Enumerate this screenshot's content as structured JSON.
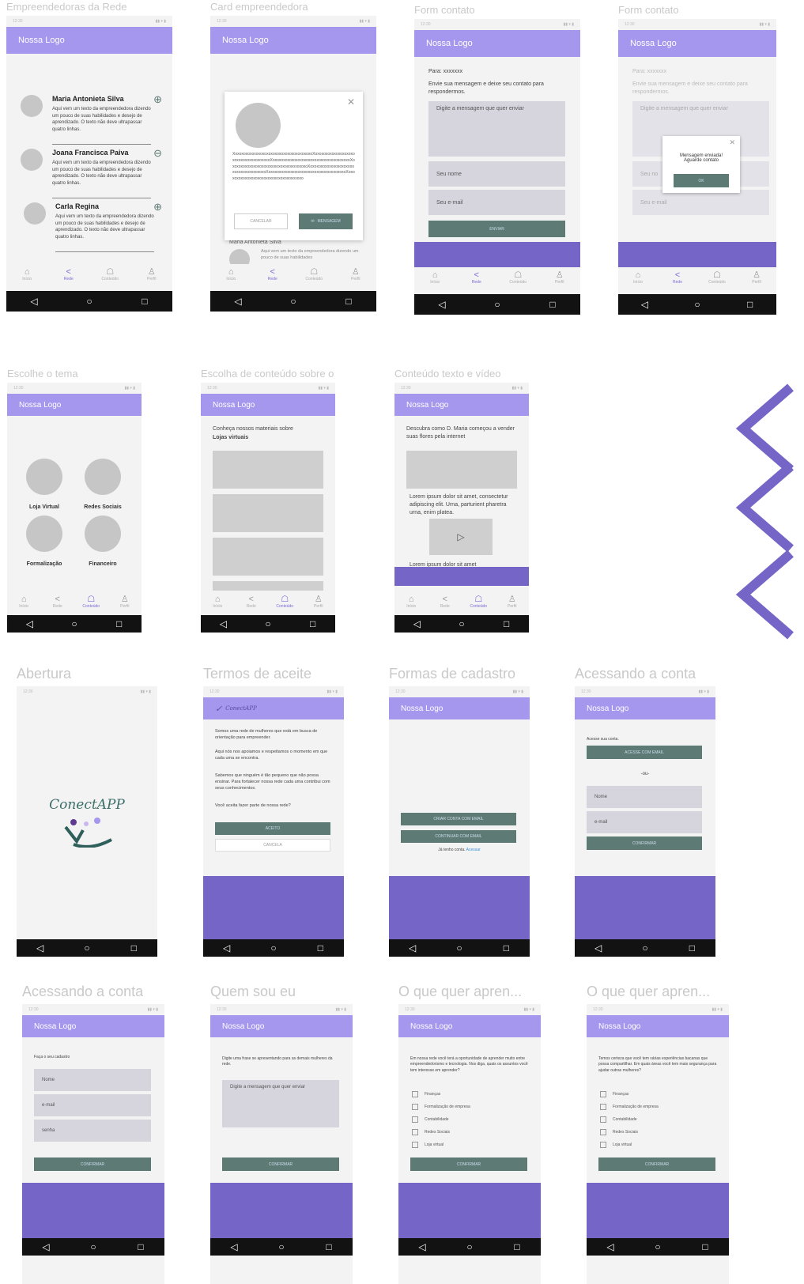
{
  "status_time": "12:30",
  "logo": "Nossa Logo",
  "tabs": [
    "Início",
    "Rede",
    "Conteúdo",
    "Perfil"
  ],
  "nav_glyphs": [
    "◁",
    "○",
    "□"
  ],
  "screens": {
    "s1": {
      "title": "Empreendedoras da Rede",
      "members": [
        {
          "name": "Maria Antonieta Silva",
          "text": "Aqui vem um texto da empreendedora dizendo um pouco de suas habilidades e desejo de aprendizado. O texto não deve ultrapassar quatro linhas.",
          "action": "⊕"
        },
        {
          "name": "Joana Francisca Paiva",
          "text": "Aqui vem um texto da empreendedora dizendo um pouco de suas habilidades e desejo de aprendizado. O texto não deve ultrapassar quatro linhas.",
          "action": "⊖"
        },
        {
          "name": "Carla Regina",
          "text": "Aqui vem um texto da empreendedora dizendo um pouco de suas habilidades e desejo de aprendizado. O texto não deve ultrapassar quatro linhas.",
          "action": "⊕"
        }
      ]
    },
    "s2": {
      "title": "Card empreendedora",
      "xo": "XoxoxoxoxoxoxoxoxoxoxoxoxoxoxoxoxoxoxoXoxoxoxoxoxoxoxoxoxoxoxoxoxoxoxoxoxoxoXoxoxoxoxoxoxoxoxoxoxoxoxoxoxoxoxoxoxoXoxoxoxoxoxoxoxoxoxoxoxoxoxoxoxoxoxoxoXoxoxoxoxoxoxoxoxoxoxoxoxoxoxoxoxoxoxoXoxoxoxoxoxoxoxoxoxoxoxoxoxoxoxoxoxoxoXoxoxoxoxoxoxoxoxoxoxoxoxoxoxoxoxoxoxo",
      "cancel": "CANCELAR",
      "message": "MENSAGEM",
      "behind_name": "Maria Antonieta Silva",
      "behind_text": "Aqui vem um texto da empreendedora dizendo um pouco de suas habilidades"
    },
    "s3": {
      "title": "Form contato",
      "to": "Para: xxxxxxx",
      "intro": "Envie sua mensagem e deixe seu contato para respondermos.",
      "msg": "Digite a mensagem que quer enviar",
      "name": "Seu nome",
      "email": "Seu e-mail",
      "send": "ENVIAR"
    },
    "s4": {
      "title": "Form contato",
      "dialog": "Mensagem enviada! Aguarde contato",
      "ok": "OK",
      "name_partial": "Seu no"
    },
    "s5": {
      "title": "Escolhe o tema",
      "themes": [
        "Loja Virtual",
        "Redes Sociais",
        "Formalização",
        "Financeiro"
      ]
    },
    "s6": {
      "title": "Escolha de conteúdo sobre o te...",
      "intro": "Conheça nossos materiais sobre",
      "bold": "Lojas virtuais"
    },
    "s7": {
      "title": "Conteúdo texto e vídeo",
      "heading": "Descubra como D. Maria começou a vender suas flores pela internet",
      "para": "Lorem ipsum dolor sit amet, consectetur adipiscing elit. Urna, parturient pharetra urna, enim platea.",
      "para2": "Lorem ipsum dolor sit amet"
    },
    "s8": {
      "title": "Abertura",
      "brand": "ConectAPP"
    },
    "s9": {
      "title": "Termos de aceite",
      "brand": "ConectAPP",
      "p1": "Somos uma rede de mulheres que está em busca de orientação para empreender.",
      "p2": "Aqui nós nos apoiamos e respeitamos o momento em que cada uma se encontra.",
      "p3": "Sabemos que ninguém é tão pequeno que não possa ensinar. Para fortalecer nossa rede cada uma contribui com seus conhecimentos.",
      "p4": "Você aceita fazer parte de nossa rede?",
      "accept": "ACEITO",
      "cancel": "CANCELA"
    },
    "s10": {
      "title": "Formas de cadastro",
      "b1": "CRIAR CONTA COM EMAIL",
      "b2": "CONTINUAR COM EMAIL",
      "has": "Já tenho conta.",
      "link": "Acessar"
    },
    "s11": {
      "title": "Acessando a conta",
      "label": "Acesse sua conta.",
      "gbtn": "ACESSE COM EMAIL",
      "or": "-ou-",
      "f1": "Nome",
      "f2": "e-mail",
      "confirm": "CONFIRMAR"
    },
    "s12": {
      "title": "Acessando a conta",
      "label": "Faça o seu cadastro",
      "f1": "Nome",
      "f2": "e-mail",
      "f3": "senha",
      "confirm": "CONFIRMAR"
    },
    "s13": {
      "title": "Quem sou eu",
      "label": "Digite uma frase se apresentando para as demais mulheres da rede.",
      "msg": "Digite a mensagem que quer enviar",
      "confirm": "CONFIRMAR"
    },
    "s14": {
      "title": "O que quer apren...",
      "label": "Em nossa rede você terá a oportunidade de aprender muito entre empreendedorismo e tecnologia. Nos diga, quais os assuntos você tem interesse em aprender?",
      "options": [
        "Finanças",
        "Formalização de empresa",
        "Contabilidade",
        "Redes Sociais",
        "Loja virtual"
      ],
      "confirm": "CONFIRMAR"
    },
    "s15": {
      "title": "O que quer apren...",
      "label": "Temos certeza que você tem várias experiências bacanas que possa compartilhar. Em quais áreas você tem mais segurança para ajudar outras mulheres?",
      "options": [
        "Finanças",
        "Formalização de empresa",
        "Contabilidade",
        "Redes Sociais",
        "Loja virtual"
      ],
      "confirm": "CONFIRMAR"
    }
  }
}
